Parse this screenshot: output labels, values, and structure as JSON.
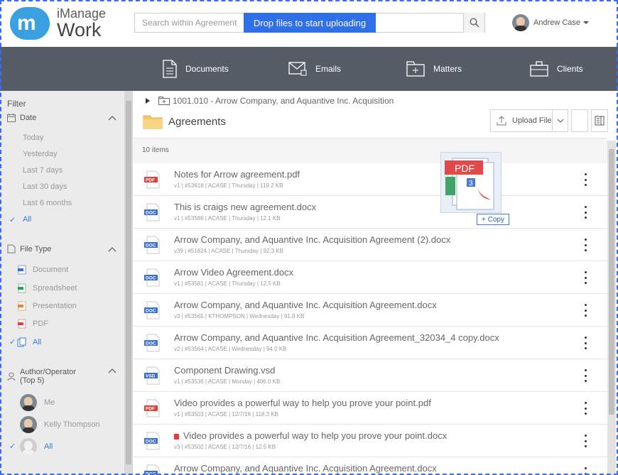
{
  "brand": {
    "line1": "iManage",
    "line2": "Work",
    "mark": "m",
    "color": "#3aa0e0"
  },
  "search": {
    "placeholder": "Search within Agreements",
    "drop_label": "Drop files to start uploading",
    "icon": "search-icon"
  },
  "user": {
    "name": "Andrew Case"
  },
  "nav": [
    {
      "label": "Documents",
      "icon": "documents-icon"
    },
    {
      "label": "Emails",
      "icon": "emails-icon"
    },
    {
      "label": "Matters",
      "icon": "matters-icon"
    },
    {
      "label": "Clients",
      "icon": "clients-icon"
    }
  ],
  "sidebar": {
    "filter_title": "Filter",
    "date": {
      "title": "Date",
      "options": [
        "Today",
        "Yesterday",
        "Last 7 days",
        "Last 30 days",
        "Last 6 months",
        "All"
      ],
      "selected": "All"
    },
    "file_type": {
      "title": "File Type",
      "options": [
        "Document",
        "Spreadsheet",
        "Presentation",
        "PDF",
        "All"
      ],
      "selected": "All"
    },
    "author": {
      "title_line1": "Author/Operator",
      "title_line2": "(Top 5)",
      "options": [
        "Me",
        "Kelly Thompson",
        "All"
      ],
      "selected": "All"
    }
  },
  "main": {
    "breadcrumb": "1001.010 - Arrow Company, and Aquantive Inc. Acquisition",
    "folder": "Agreements",
    "upload_label": "Upload File",
    "item_count": "10 items",
    "accent": "#2f6fe8",
    "rows": [
      {
        "type": "PDF",
        "name": "Notes for Arrow agreement.pdf",
        "meta": "v1 | #53618 | ACASE | Thursday | 119.2 KB",
        "locked": false
      },
      {
        "type": "DOC",
        "name": "This is craigs new agreement.docx",
        "meta": "v1 | #53586 | ACASE | Thursday | 12.1 KB",
        "locked": false
      },
      {
        "type": "DOC",
        "name": "Arrow Company, and Aquantive Inc. Acquisition Agreement (2).docx",
        "meta": "v39 | #51824 | ACASE | Thursday | 92.3 KB",
        "locked": false
      },
      {
        "type": "DOC",
        "name": "Arrow Video Agreement.docx",
        "meta": "v1 | #53581 | ACASE | Thursday | 12.5 KB",
        "locked": false
      },
      {
        "type": "DOC",
        "name": "Arrow Company, and Aquantive Inc. Acquisition Agreement.docx",
        "meta": "v3 | #53565 | KTHOMPSON | Wednesday | 91.8 KB",
        "locked": false
      },
      {
        "type": "DOC",
        "name": "Arrow Company, and Aquantive Inc. Acquisition Agreement_32034_4 copy.docx",
        "meta": "v2 | #53564 | ACASE | Wednesday | 94.0 KB",
        "locked": false
      },
      {
        "type": "VSD",
        "name": "Component Drawing.vsd",
        "meta": "v1 | #53536 | ACASE | Monday | 406.0 KB",
        "locked": false
      },
      {
        "type": "PDF",
        "name": "Video provides a powerful way to help you prove your point.pdf",
        "meta": "v1 | #53503 | ACASE | 12/7/16 | 118.3 KB",
        "locked": false
      },
      {
        "type": "DOC",
        "name": "Video provides a powerful way to help you prove your point.docx",
        "meta": "v3 | #53502 | ACASE | 12/7/16 | 12.5 KB",
        "locked": true
      },
      {
        "type": "DOC",
        "name": "Arrow Company, and Aquantive Inc. Acquisition Agreement.docx",
        "meta": "",
        "locked": false
      }
    ]
  },
  "drag": {
    "badge_pdf": "PDF",
    "badge_num": "3",
    "copy_label": "+ Copy"
  },
  "type_colors": {
    "PDF": "#d9413a",
    "DOC": "#3b6fd6",
    "VSD": "#3b6fd6"
  }
}
